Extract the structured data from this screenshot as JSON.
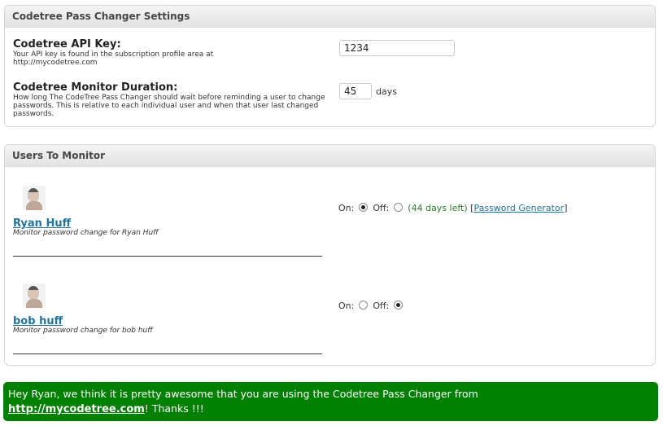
{
  "settings_panel": {
    "title": "Codetree Pass Changer Settings",
    "api_key": {
      "label": "Codetree API Key:",
      "description": "Your API key is found in the subscription profile area at http://mycodetree.com",
      "value": "1234"
    },
    "duration": {
      "label": "Codetree Monitor Duration:",
      "description": "How long The CodeTree Pass Changer should wait before reminding a user to change passwords. This is relative to each individual user and when that user last changed passwords.",
      "value": "45",
      "unit": "days"
    }
  },
  "users_panel": {
    "title": "Users To Monitor",
    "on_label": "On:",
    "off_label": "Off:",
    "users": [
      {
        "name": "Ryan Huff",
        "description": "Monitor password change for Ryan Huff",
        "monitor_on": true,
        "days_left": "(44 days left)",
        "bracket_open": "[",
        "password_generator": "Password Generator",
        "bracket_close": "]"
      },
      {
        "name": "bob huff",
        "description": "Monitor password change for bob huff",
        "monitor_on": false
      }
    ]
  },
  "banner": {
    "text_before": "Hey Ryan, we think it is pretty awesome that you are using the Codetree Pass Changer from",
    "link": "http://mycodetree.com",
    "text_after": "! Thanks !!!",
    "color": "#008000"
  }
}
